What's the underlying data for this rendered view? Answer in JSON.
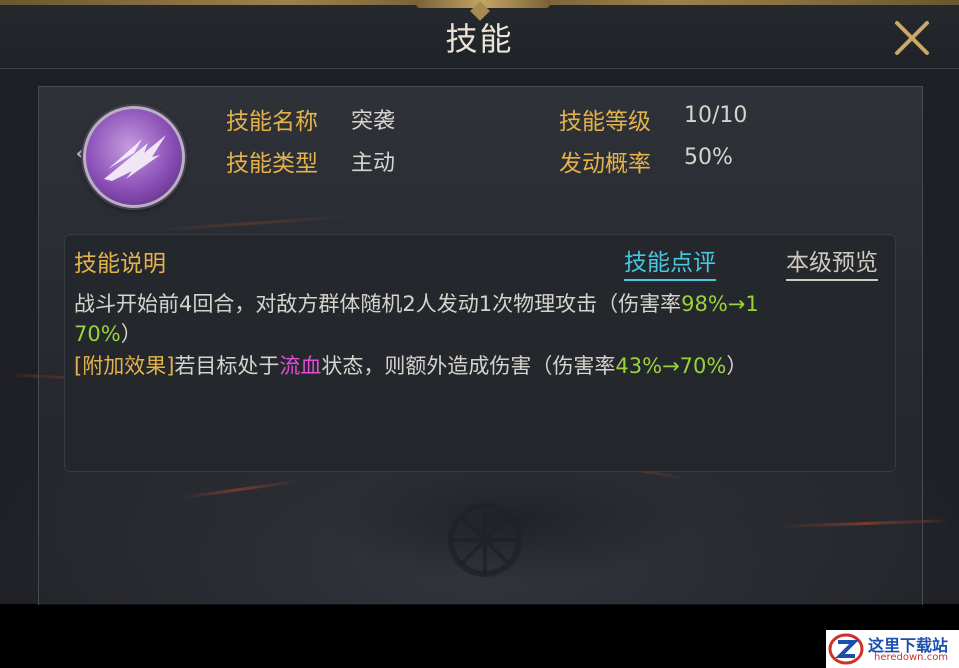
{
  "dialog": {
    "title": "技能",
    "close_icon": "close-icon"
  },
  "skill": {
    "icon": "claw-slash-icon",
    "name_label": "技能名称",
    "name_value": "突袭",
    "level_label": "技能等级",
    "level_value": "10/10",
    "type_label": "技能类型",
    "type_value": "主动",
    "chance_label": "发动概率",
    "chance_value": "50%"
  },
  "description": {
    "title": "技能说明",
    "review_link": "技能点评",
    "preview_link": "本级预览",
    "line1_text": "战斗开始前4回合，对敌方群体随机2人发动1次物理攻击（伤害率",
    "line1_rate": "98%→1",
    "line2_rate": "70%",
    "line2_text": "）",
    "line3_tag": "[附加效果]",
    "line3_text_a": "若目标处于",
    "line3_status": "流血",
    "line3_text_b": "状态，则额外造成伤害（伤害率",
    "line3_rate": "43%→70%",
    "line3_text_c": "）"
  },
  "colors": {
    "label_gold": "#e4b24a",
    "value_green": "#9ad23a",
    "status_magenta": "#e14fd6",
    "link_cyan": "#46c8e0"
  },
  "watermark": {
    "name": "这里下载站",
    "url": "heredown.com"
  }
}
